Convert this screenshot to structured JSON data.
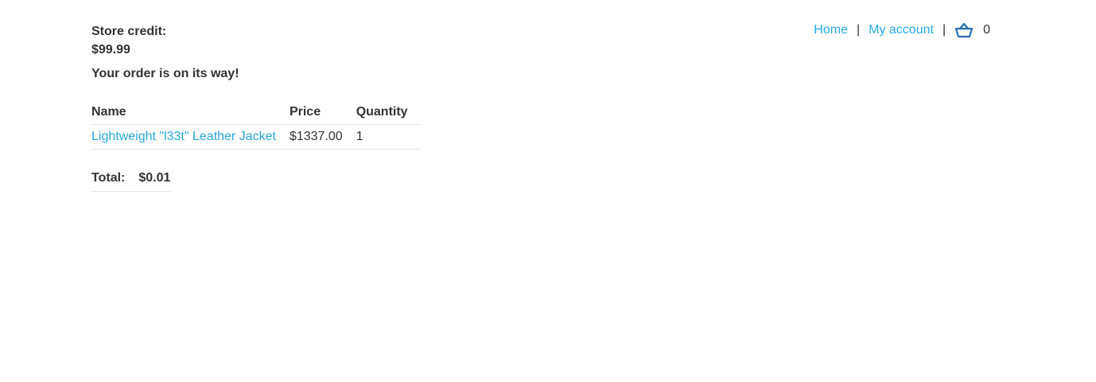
{
  "store_credit": {
    "label": "Store credit:",
    "amount": "$99.99"
  },
  "nav": {
    "home": "Home",
    "separator": "|",
    "account": "My account",
    "cart_icon": "basket-icon",
    "cart_count": "0"
  },
  "status_message": "Your order is on its way!",
  "order_table": {
    "headers": [
      "Name",
      "Price",
      "Quantity"
    ],
    "rows": [
      {
        "name": "Lightweight \"l33t\" Leather Jacket",
        "price": "$1337.00",
        "quantity": "1"
      }
    ]
  },
  "total": {
    "label": "Total:",
    "value": "$0.01"
  },
  "colors": {
    "link": "#29a8e0",
    "text": "#333333",
    "icon": "#2c6fb0"
  }
}
